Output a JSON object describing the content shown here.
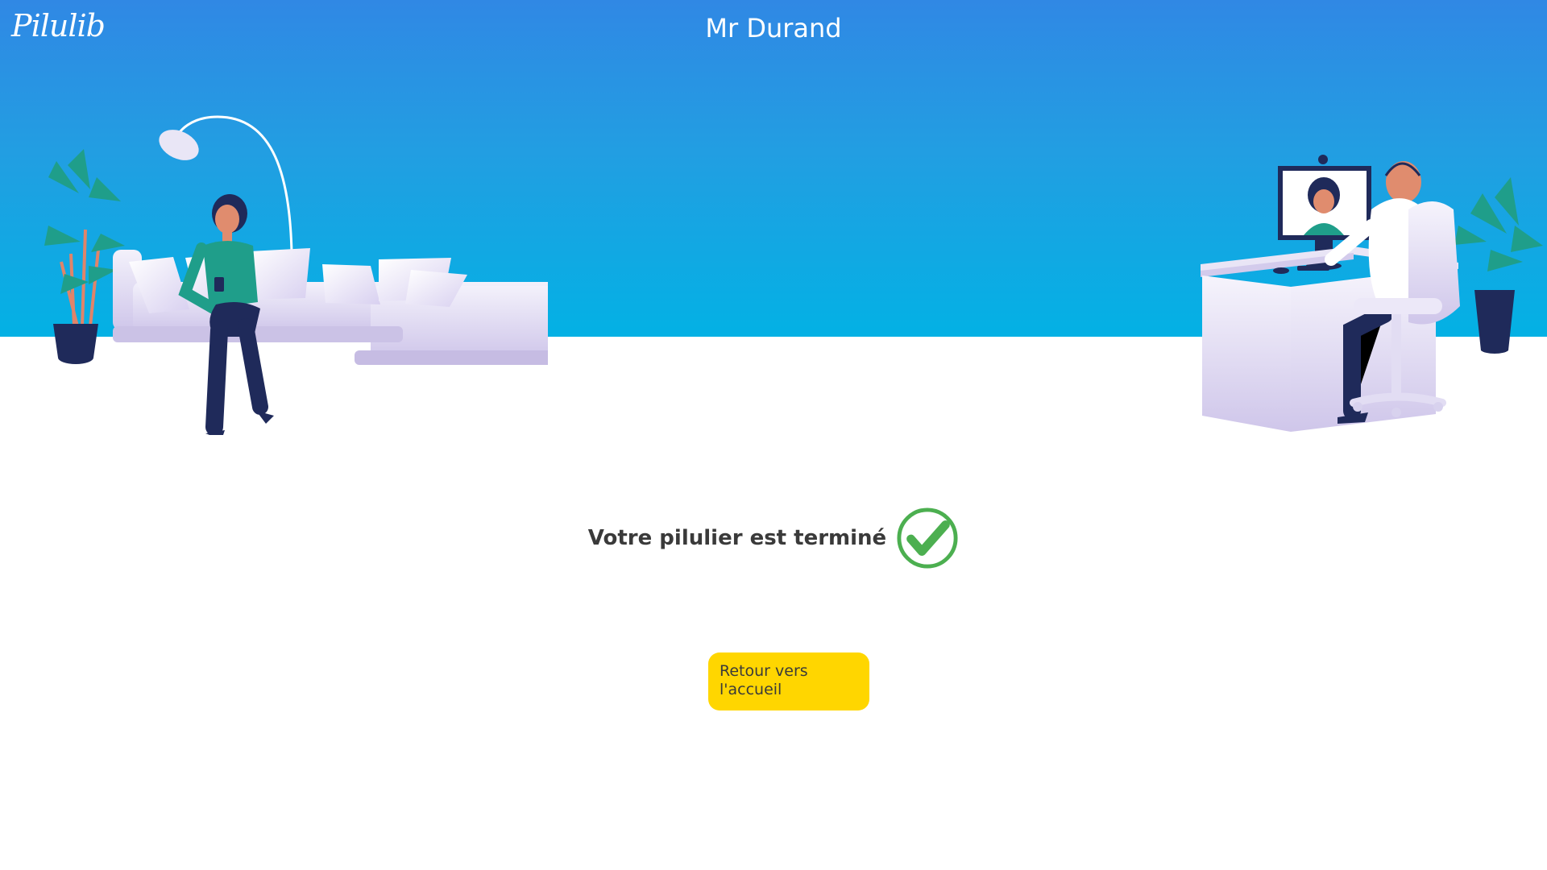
{
  "header": {
    "brand": "Pilulib",
    "patient_name": "Mr Durand"
  },
  "main": {
    "status_message": "Votre pilulier est terminé",
    "status_icon": "check-circle-icon",
    "back_button_label": "Retour vers l'accueil"
  },
  "colors": {
    "hero_gradient": [
      "#3088e4",
      "#229ee2",
      "#03b1e4"
    ],
    "button_background": "#ffd600",
    "check_color": "#4caf50",
    "text_color": "#3a3a3a"
  }
}
